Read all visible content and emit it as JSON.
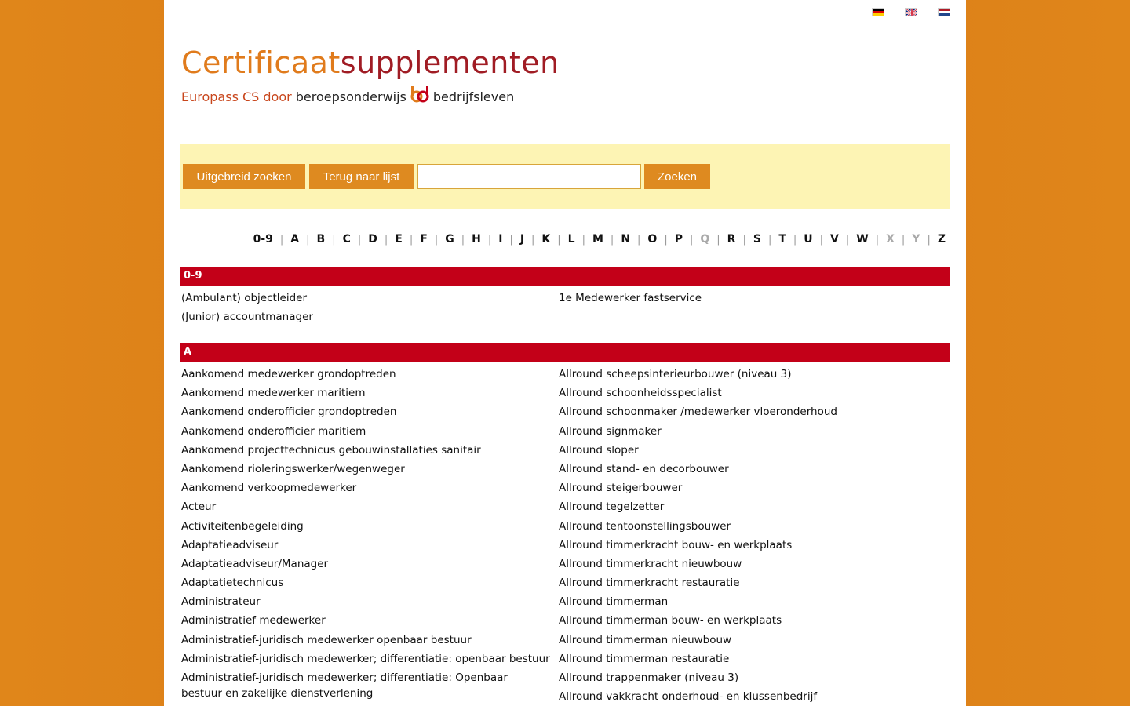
{
  "header": {
    "title_part1": "Certificaat",
    "title_part2": "supplementen",
    "subtitle_part1": "Europass CS door",
    "subtitle_part2": "beroepsonderwijs",
    "subtitle_part3": "bedrijfsleven"
  },
  "flags": [
    "flag-de-icon",
    "flag-en-icon",
    "flag-nl-icon"
  ],
  "search": {
    "advanced_label": "Uitgebreid zoeken",
    "back_label": "Terug naar lijst",
    "search_label": "Zoeken",
    "value": ""
  },
  "alphabet": [
    {
      "label": "0-9",
      "enabled": true
    },
    {
      "label": "A",
      "enabled": true
    },
    {
      "label": "B",
      "enabled": true
    },
    {
      "label": "C",
      "enabled": true
    },
    {
      "label": "D",
      "enabled": true
    },
    {
      "label": "E",
      "enabled": true
    },
    {
      "label": "F",
      "enabled": true
    },
    {
      "label": "G",
      "enabled": true
    },
    {
      "label": "H",
      "enabled": true
    },
    {
      "label": "I",
      "enabled": true
    },
    {
      "label": "J",
      "enabled": true
    },
    {
      "label": "K",
      "enabled": true
    },
    {
      "label": "L",
      "enabled": true
    },
    {
      "label": "M",
      "enabled": true
    },
    {
      "label": "N",
      "enabled": true
    },
    {
      "label": "O",
      "enabled": true
    },
    {
      "label": "P",
      "enabled": true
    },
    {
      "label": "Q",
      "enabled": false
    },
    {
      "label": "R",
      "enabled": true
    },
    {
      "label": "S",
      "enabled": true
    },
    {
      "label": "T",
      "enabled": true
    },
    {
      "label": "U",
      "enabled": true
    },
    {
      "label": "V",
      "enabled": true
    },
    {
      "label": "W",
      "enabled": true
    },
    {
      "label": "X",
      "enabled": false
    },
    {
      "label": "Y",
      "enabled": false
    },
    {
      "label": "Z",
      "enabled": true
    }
  ],
  "sections": [
    {
      "label": "0-9",
      "left": [
        "(Ambulant) objectleider",
        "(Junior) accountmanager"
      ],
      "right": [
        "1e Medewerker fastservice"
      ]
    },
    {
      "label": "A",
      "left": [
        "Aankomend medewerker grondoptreden",
        "Aankomend medewerker maritiem",
        "Aankomend onderofficier grondoptreden",
        "Aankomend onderofficier maritiem",
        "Aankomend projecttechnicus gebouwinstallaties sanitair",
        "Aankomend rioleringswerker/wegenweger",
        "Aankomend verkoopmedewerker",
        "Acteur",
        "Activiteitenbegeleiding",
        "Adaptatieadviseur",
        "Adaptatieadviseur/Manager",
        "Adaptatietechnicus",
        "Administrateur",
        "Administratief medewerker",
        "Administratief-juridisch medewerker openbaar bestuur",
        "Administratief-juridisch medewerker; differentiatie: openbaar bestuur",
        "Administratief-juridisch medewerker; differentiatie: Openbaar bestuur en zakelijke dienstverlening"
      ],
      "right": [
        "Allround scheepsinterieurbouwer (niveau 3)",
        "Allround schoonheidsspecialist",
        "Allround schoonmaker /medewerker vloeronderhoud",
        "Allround signmaker",
        "Allround sloper",
        "Allround stand- en decorbouwer",
        "Allround steigerbouwer",
        "Allround tegelzetter",
        "Allround tentoonstellingsbouwer",
        "Allround timmerkracht bouw- en werkplaats",
        "Allround timmerkracht nieuwbouw",
        "Allround timmerkracht restauratie",
        "Allround timmerman",
        "Allround timmerman bouw- en werkplaats",
        "Allround timmerman nieuwbouw",
        "Allround timmerman restauratie",
        "Allround trappenmaker (niveau 3)",
        "Allround vakkracht onderhoud- en klussenbedrijf"
      ]
    }
  ]
}
